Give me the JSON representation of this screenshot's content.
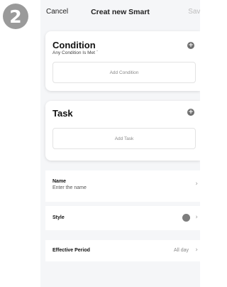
{
  "step_badge": "2",
  "nav": {
    "cancel": "Cancel",
    "title": "Creat new Smart",
    "save": "Save"
  },
  "condition": {
    "title": "Condition",
    "subtitle": "Any Condition Is Met",
    "subtitle_caret": "ˇ",
    "add_label": "Add Condition",
    "plus": "+"
  },
  "task": {
    "title": "Task",
    "add_label": "Add Task",
    "plus": "+"
  },
  "name_row": {
    "title": "Name",
    "placeholder": "Enter the name",
    "chevron": "›"
  },
  "style_row": {
    "title": "Style",
    "chevron": "›",
    "dot_color": "#7d7d7d"
  },
  "period_row": {
    "title": "Effective Period",
    "value": "All day",
    "chevron": "›"
  }
}
